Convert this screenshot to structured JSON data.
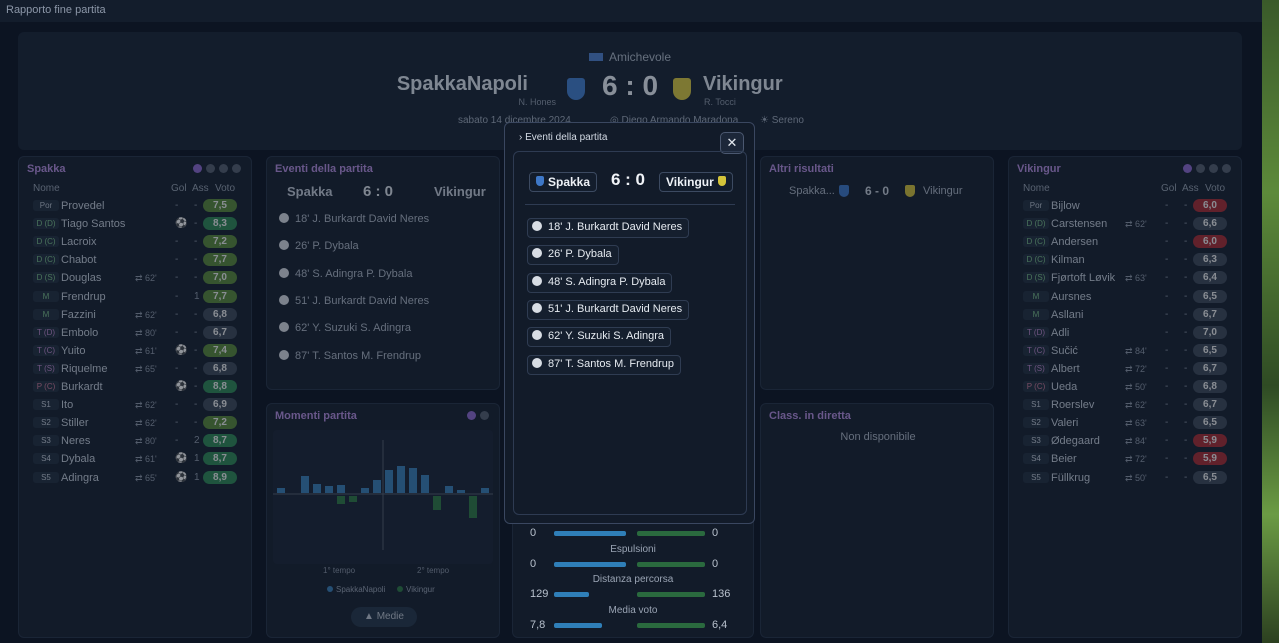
{
  "window_title": "Rapporto fine partita",
  "match": {
    "competition": "Amichevole",
    "home": "SpakkaNapoli",
    "away": "Vikingur",
    "home_coach": "N. Hones",
    "away_coach": "R. Tocci",
    "score": "6 : 0",
    "date": "sabato 14 dicembre 2024",
    "stadium": "Diego Armando Maradona",
    "weather": "Sereno"
  },
  "home_panel": {
    "title": "Spakka",
    "col_name": "Nome",
    "col_gol": "Gol",
    "col_ass": "Ass",
    "col_voto": "Voto",
    "players": [
      {
        "pos": "Por",
        "name": "Provedel",
        "sub": "",
        "gol": "-",
        "ass": "-",
        "voto": "7,5",
        "c": "#5a8a3a"
      },
      {
        "pos": "D (D)",
        "name": "Tiago Santos",
        "sub": "",
        "gol": "⚽",
        "ass": "-",
        "voto": "8,3",
        "c": "#2f8a55"
      },
      {
        "pos": "D (C)",
        "name": "Lacroix",
        "sub": "",
        "gol": "-",
        "ass": "-",
        "voto": "7,2",
        "c": "#5a8a3a"
      },
      {
        "pos": "D (C)",
        "name": "Chabot",
        "sub": "",
        "gol": "-",
        "ass": "-",
        "voto": "7,7",
        "c": "#5a8a3a"
      },
      {
        "pos": "D (S)",
        "name": "Douglas",
        "sub": "62'",
        "gol": "-",
        "ass": "-",
        "voto": "7,0",
        "c": "#5a8a3a"
      },
      {
        "pos": "M",
        "name": "Frendrup",
        "sub": "",
        "gol": "-",
        "ass": "1",
        "voto": "7,7",
        "c": "#5a8a3a"
      },
      {
        "pos": "M",
        "name": "Fazzini",
        "sub": "62'",
        "gol": "-",
        "ass": "-",
        "voto": "6,8",
        "c": "#3e4a5a"
      },
      {
        "pos": "T (D)",
        "name": "Embolo",
        "sub": "80'",
        "gol": "-",
        "ass": "-",
        "voto": "6,7",
        "c": "#3e4a5a"
      },
      {
        "pos": "T (C)",
        "name": "Yuito",
        "sub": "61'",
        "gol": "⚽",
        "ass": "-",
        "voto": "7,4",
        "c": "#5a8a3a"
      },
      {
        "pos": "T (S)",
        "name": "Riquelme",
        "sub": "65'",
        "gol": "-",
        "ass": "-",
        "voto": "6,8",
        "c": "#3e4a5a"
      },
      {
        "pos": "P (C)",
        "name": "Burkardt",
        "sub": "",
        "gol": "⚽",
        "ass": "-",
        "voto": "8,8",
        "c": "#2f8a55"
      },
      {
        "pos": "S1",
        "name": "Ito",
        "sub": "62'",
        "gol": "-",
        "ass": "-",
        "voto": "6,9",
        "c": "#3e4a5a"
      },
      {
        "pos": "S2",
        "name": "Stiller",
        "sub": "62'",
        "gol": "-",
        "ass": "-",
        "voto": "7,2",
        "c": "#5a8a3a"
      },
      {
        "pos": "S3",
        "name": "Neres",
        "sub": "80'",
        "gol": "-",
        "ass": "2",
        "voto": "8,7",
        "c": "#2f8a55"
      },
      {
        "pos": "S4",
        "name": "Dybala",
        "sub": "61'",
        "gol": "⚽",
        "ass": "1",
        "voto": "8,7",
        "c": "#2f8a55"
      },
      {
        "pos": "S5",
        "name": "Adingra",
        "sub": "65'",
        "gol": "⚽",
        "ass": "1",
        "voto": "8,9",
        "c": "#2f8a55"
      }
    ]
  },
  "away_panel": {
    "title": "Vikingur",
    "col_name": "Nome",
    "col_gol": "Gol",
    "col_ass": "Ass",
    "col_voto": "Voto",
    "players": [
      {
        "pos": "Por",
        "name": "Bijlow",
        "sub": "",
        "gol": "-",
        "ass": "-",
        "voto": "6,0",
        "c": "#a82c34"
      },
      {
        "pos": "D (D)",
        "name": "Carstensen",
        "sub": "62'",
        "gol": "-",
        "ass": "-",
        "voto": "6,6",
        "c": "#3e4a5a"
      },
      {
        "pos": "D (C)",
        "name": "Andersen",
        "sub": "",
        "gol": "-",
        "ass": "-",
        "voto": "6,0",
        "c": "#a82c34"
      },
      {
        "pos": "D (C)",
        "name": "Kilman",
        "sub": "",
        "gol": "-",
        "ass": "-",
        "voto": "6,3",
        "c": "#3e4a5a"
      },
      {
        "pos": "D (S)",
        "name": "Fjørtoft Løvik",
        "sub": "63'",
        "gol": "-",
        "ass": "-",
        "voto": "6,4",
        "c": "#3e4a5a"
      },
      {
        "pos": "M",
        "name": "Aursnes",
        "sub": "",
        "gol": "-",
        "ass": "-",
        "voto": "6,5",
        "c": "#3e4a5a"
      },
      {
        "pos": "M",
        "name": "Asllani",
        "sub": "",
        "gol": "-",
        "ass": "-",
        "voto": "6,7",
        "c": "#3e4a5a"
      },
      {
        "pos": "T (D)",
        "name": "Adli",
        "sub": "",
        "gol": "-",
        "ass": "-",
        "voto": "7,0",
        "c": "#3e4a5a"
      },
      {
        "pos": "T (C)",
        "name": "Sučić",
        "sub": "84'",
        "gol": "-",
        "ass": "-",
        "voto": "6,5",
        "c": "#3e4a5a"
      },
      {
        "pos": "T (S)",
        "name": "Albert",
        "sub": "72'",
        "gol": "-",
        "ass": "-",
        "voto": "6,7",
        "c": "#3e4a5a"
      },
      {
        "pos": "P (C)",
        "name": "Ueda",
        "sub": "50'",
        "gol": "-",
        "ass": "-",
        "voto": "6,8",
        "c": "#3e4a5a"
      },
      {
        "pos": "S1",
        "name": "Roerslev",
        "sub": "62'",
        "gol": "-",
        "ass": "-",
        "voto": "6,7",
        "c": "#3e4a5a"
      },
      {
        "pos": "S2",
        "name": "Valeri",
        "sub": "63'",
        "gol": "-",
        "ass": "-",
        "voto": "6,5",
        "c": "#3e4a5a"
      },
      {
        "pos": "S3",
        "name": "Ødegaard",
        "sub": "84'",
        "gol": "-",
        "ass": "-",
        "voto": "5,9",
        "c": "#a82c34"
      },
      {
        "pos": "S4",
        "name": "Beier",
        "sub": "72'",
        "gol": "-",
        "ass": "-",
        "voto": "5,9",
        "c": "#a82c34"
      },
      {
        "pos": "S5",
        "name": "Füllkrug",
        "sub": "50'",
        "gol": "-",
        "ass": "-",
        "voto": "6,5",
        "c": "#3e4a5a"
      }
    ]
  },
  "events_panel": {
    "title": "Eventi della partita",
    "home": "Spakka",
    "away": "Vikingur",
    "score": "6 : 0"
  },
  "events": [
    "18' J. Burkardt David Neres",
    "26' P. Dybala",
    "48' S. Adingra P. Dybala",
    "51' J. Burkardt David Neres",
    "62' Y. Suzuki S. Adingra",
    "87' T. Santos M. Frendrup"
  ],
  "moments_panel": {
    "title": "Momenti partita",
    "first_half": "1° tempo",
    "second_half": "2° tempo",
    "legend_home": "SpakkaNapoli",
    "legend_away": "Vikingur",
    "button": "Medie"
  },
  "other_results": {
    "title": "Altri risultati",
    "home": "Spakka...",
    "score": "6 - 0",
    "away": "Vikingur"
  },
  "live_table": {
    "title": "Class. in diretta",
    "text": "Non disponibile"
  },
  "stats": [
    {
      "label": "",
      "home": "0",
      "away": "0",
      "hv": 0,
      "av": 0
    },
    {
      "label": "Espulsioni",
      "home": "0",
      "away": "0",
      "hv": 0,
      "av": 0
    },
    {
      "label": "Distanza percorsa",
      "home": "129",
      "away": "136",
      "hv": 129,
      "av": 136
    },
    {
      "label": "Media voto",
      "home": "7,8",
      "away": "6,4",
      "hv": 7.8,
      "av": 6.4
    }
  ],
  "modal": {
    "title": "Eventi della partita",
    "home": "Spakka",
    "away": "Vikingur",
    "score": "6 : 0",
    "close": "✕"
  }
}
